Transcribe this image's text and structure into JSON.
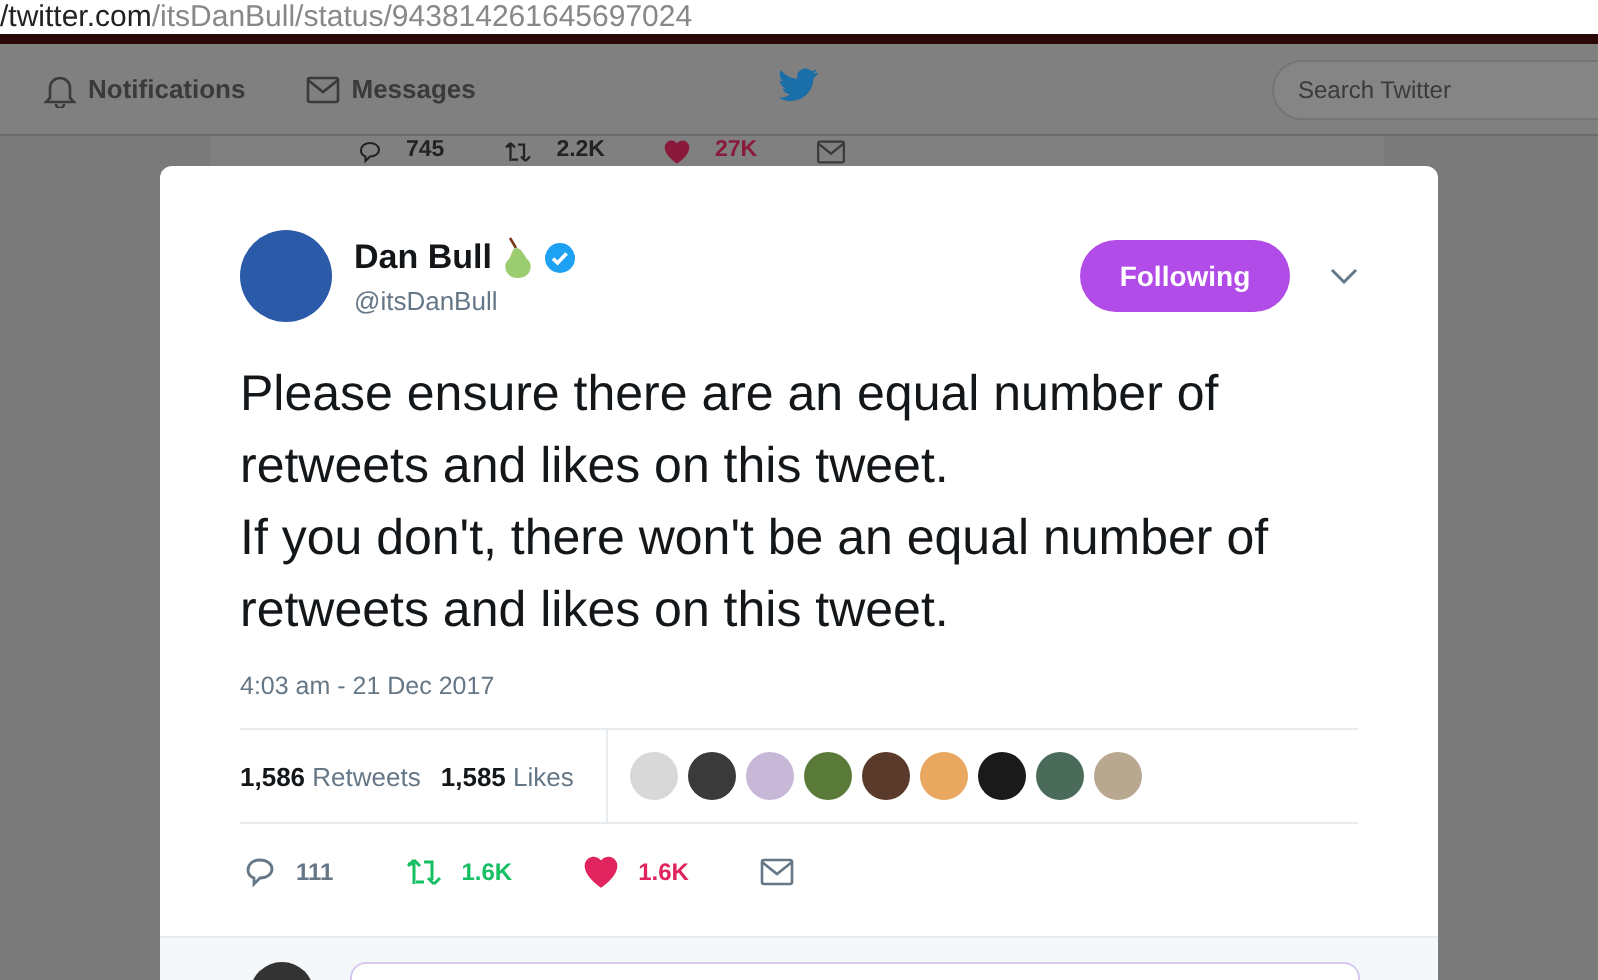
{
  "address_bar": {
    "domain": "/twitter.com",
    "path": "/itsDanBull/status/943814261645697024"
  },
  "nav": {
    "items": [
      {
        "label": "Notifications",
        "kind": "bell"
      },
      {
        "label": "Messages",
        "kind": "mail"
      }
    ],
    "search": {
      "placeholder": "Search Twitter"
    }
  },
  "background_tweet": {
    "replies": "745",
    "retweets": "2.2K",
    "likes": "27K",
    "liked": true,
    "retweeted": false
  },
  "tweet": {
    "name": "Dan Bull",
    "handle": "@itsDanBull",
    "verified": true,
    "follow_button": "Following",
    "following": true,
    "text": "Please ensure there are an equal number of retweets and likes on this tweet.\nIf you don't, there won't be an equal number of retweets and likes on this tweet.",
    "time": "4:03 am - 21 Dec 2017",
    "stats": [
      {
        "count": "1,586",
        "label": "Retweets"
      },
      {
        "count": "1,585",
        "label": "Likes"
      }
    ],
    "likers": [
      {
        "color": "#d8d8d8"
      },
      {
        "color": "#3a3a3a"
      },
      {
        "color": "#c8b8d8"
      },
      {
        "color": "#5a7a3a"
      },
      {
        "color": "#5a3a2a"
      },
      {
        "color": "#e8a860"
      },
      {
        "color": "#1a1a1a"
      },
      {
        "color": "#4a6a5a"
      },
      {
        "color": "#b8a890"
      }
    ],
    "actions": {
      "replies": "111",
      "retweets": "1.6K",
      "likes": "1.6K",
      "retweeted": true,
      "liked": true
    }
  },
  "reply": {
    "field": true
  }
}
